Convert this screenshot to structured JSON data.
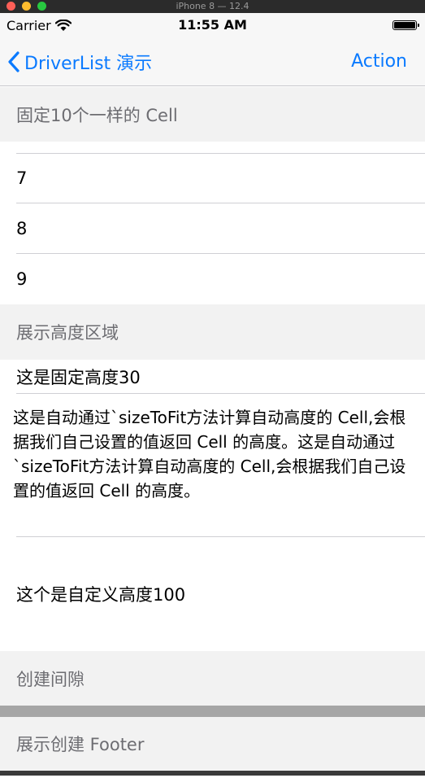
{
  "window": {
    "title": "iPhone 8 — 12.4"
  },
  "status_bar": {
    "carrier": "Carrier",
    "time": "11:55 AM",
    "battery_level": 1.0
  },
  "nav": {
    "back_label": "DriverList 演示",
    "action_label": "Action"
  },
  "sections": [
    {
      "header": "固定10个一样的 Cell",
      "rows": [
        "7",
        "8",
        "9"
      ]
    },
    {
      "header": "展示高度区域",
      "rows": [
        "这是固定高度30",
        "这是自动通过`sizeToFit方法计算自动高度的 Cell,会根据我们自己设置的值返回 Cell 的高度。这是自动通过`sizeToFit方法计算自动高度的 Cell,会根据我们自己设置的值返回 Cell 的高度。",
        "这个是自定义高度100"
      ]
    },
    {
      "header": "创建间隙"
    },
    {
      "header": "展示创建 Footer"
    }
  ],
  "colors": {
    "tint": "#0a7aff",
    "section_bg": "#f2f2f2",
    "section_text": "#6d6d72"
  }
}
